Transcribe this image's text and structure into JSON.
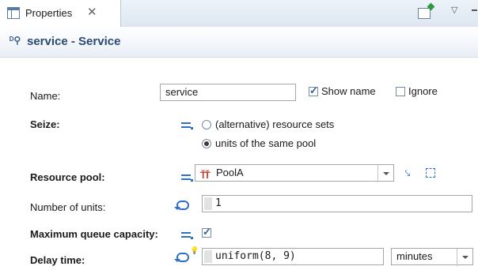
{
  "tab": {
    "label": "Properties",
    "close_glyph": "✕"
  },
  "header": {
    "icon_glyph": "ᴰ⚲",
    "title": "service - Service"
  },
  "form": {
    "name": {
      "label": "Name:",
      "value": "service",
      "show_name_label": "Show name",
      "show_name_checked": true,
      "ignore_label": "Ignore",
      "ignore_checked": false
    },
    "seize": {
      "label": "Seize:",
      "option1": "(alternative) resource sets",
      "option2": "units of the same pool",
      "selected": "units of the same pool"
    },
    "resource_pool": {
      "label": "Resource pool:",
      "value": "PoolA",
      "icon": "pool-icon"
    },
    "number_of_units": {
      "label": "Number of units:",
      "value": "1"
    },
    "max_queue": {
      "label": "Maximum queue capacity:",
      "checked": true
    },
    "delay_time": {
      "label": "Delay time:",
      "value": "uniform(8, 9)",
      "unit": "minutes"
    }
  },
  "colors": {
    "accent": "#2e6fc9",
    "header_title": "#2a4a73"
  }
}
